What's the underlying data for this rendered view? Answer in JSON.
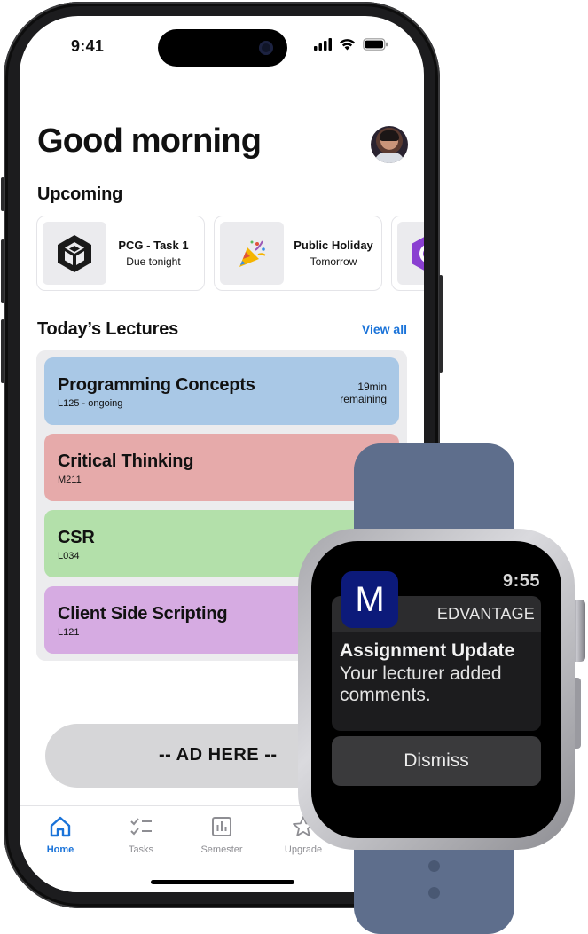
{
  "phone": {
    "status": {
      "time": "9:41"
    },
    "greeting": "Good morning",
    "upcoming": {
      "title": "Upcoming",
      "items": [
        {
          "name": "PCG - Task 1",
          "when": "Due tonight",
          "icon": "unity-cube-icon"
        },
        {
          "name": "Public Holiday",
          "when": "Tomorrow",
          "icon": "party-popper-icon"
        },
        {
          "name": "",
          "when": "",
          "icon": "csharp-hexagon-icon"
        }
      ]
    },
    "lectures": {
      "title": "Today’s Lectures",
      "view_all": "View all",
      "items": [
        {
          "name": "Programming Concepts",
          "room": "L125 - ongoing",
          "remaining": [
            "19min",
            "remaining"
          ],
          "color": "#a9c8e6"
        },
        {
          "name": "Critical Thinking",
          "room": "M211",
          "color": "#e6aaaa"
        },
        {
          "name": "CSR",
          "room": "L034",
          "color": "#b3e0aa"
        },
        {
          "name": "Client Side Scripting",
          "room": "L121",
          "color": "#d6abe2"
        }
      ]
    },
    "ad": {
      "text": "-- AD HERE --"
    },
    "tabbar": {
      "tabs": [
        {
          "label": "Home",
          "icon": "home-icon",
          "active": true
        },
        {
          "label": "Tasks",
          "icon": "tasks-checklist-icon"
        },
        {
          "label": "Semester",
          "icon": "bar-chart-icon"
        },
        {
          "label": "Upgrade",
          "icon": "star-icon"
        }
      ]
    },
    "accent_color": "#1a73d9"
  },
  "watch": {
    "time": "9:55",
    "app_name": "EDVANTAGE",
    "app_icon_letter": "M",
    "app_icon_color": "#0c1a7a",
    "notification": {
      "title": "Assignment Update",
      "message": "Your lecturer added comments."
    },
    "dismiss_label": "Dismiss",
    "band_color": "#5e6e8c"
  }
}
